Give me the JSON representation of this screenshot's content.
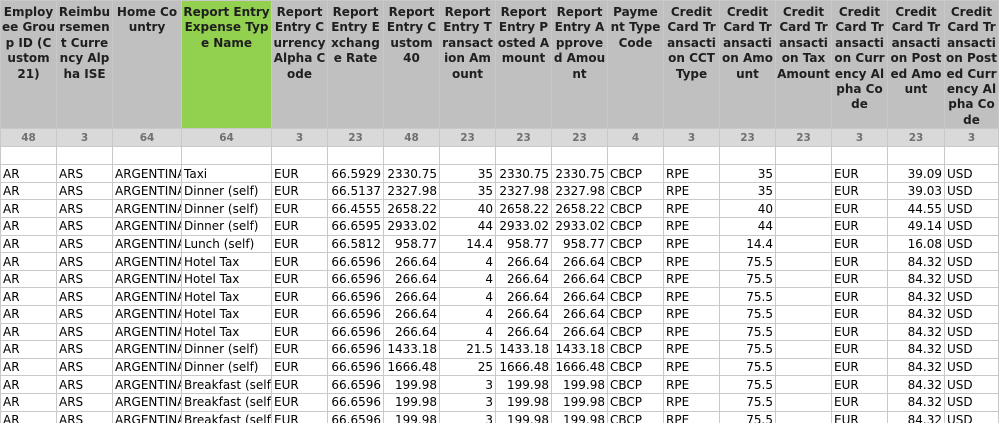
{
  "columns": [
    {
      "header": "Employee Group ID (Custom 21)",
      "length": "48",
      "align": "txt",
      "highlight": false
    },
    {
      "header": "Reimbursement Currency Alpha ISE",
      "length": "3",
      "align": "txt",
      "highlight": false
    },
    {
      "header": "Home Country",
      "length": "64",
      "align": "txt",
      "highlight": false
    },
    {
      "header": "Report Entry Expense Type Name",
      "length": "64",
      "align": "txt",
      "highlight": true
    },
    {
      "header": "Report Entry Currency Alpha Code",
      "length": "3",
      "align": "txt",
      "highlight": false
    },
    {
      "header": "Report Entry Exchange Rate",
      "length": "23",
      "align": "num",
      "highlight": false
    },
    {
      "header": "Report Entry Custom 40",
      "length": "48",
      "align": "num",
      "highlight": false
    },
    {
      "header": "Report Entry Transaction Amount",
      "length": "23",
      "align": "num",
      "highlight": false
    },
    {
      "header": "Report Entry Posted Amount",
      "length": "23",
      "align": "num",
      "highlight": false
    },
    {
      "header": "Report Entry Approved Amount",
      "length": "23",
      "align": "num",
      "highlight": false
    },
    {
      "header": "Payment Type Code",
      "length": "4",
      "align": "txt",
      "highlight": false
    },
    {
      "header": "Credit Card Transaction CCT Type",
      "length": "3",
      "align": "txt",
      "highlight": false
    },
    {
      "header": "Credit Card Transaction Amount",
      "length": "23",
      "align": "num",
      "highlight": false
    },
    {
      "header": "Credit Card Transaction Tax Amount",
      "length": "23",
      "align": "num",
      "highlight": false
    },
    {
      "header": "Credit Card Transaction Currency Alpha Code",
      "length": "3",
      "align": "txt",
      "highlight": false
    },
    {
      "header": "Credit Card Transaction Posted Amount",
      "length": "23",
      "align": "num",
      "highlight": false
    },
    {
      "header": "Credit Card Transaction Posted Currency Alpha Code",
      "length": "3",
      "align": "txt",
      "highlight": false
    }
  ],
  "rows": [
    [
      "AR",
      "ARS",
      "ARGENTINA",
      "Taxi",
      "EUR",
      "66.5929",
      "2330.75",
      "35",
      "2330.75",
      "2330.75",
      "CBCP",
      "RPE",
      "35",
      "",
      "EUR",
      "39.09",
      "USD"
    ],
    [
      "AR",
      "ARS",
      "ARGENTINA",
      "Dinner (self)",
      "EUR",
      "66.5137",
      "2327.98",
      "35",
      "2327.98",
      "2327.98",
      "CBCP",
      "RPE",
      "35",
      "",
      "EUR",
      "39.03",
      "USD"
    ],
    [
      "AR",
      "ARS",
      "ARGENTINA",
      "Dinner (self)",
      "EUR",
      "66.4555",
      "2658.22",
      "40",
      "2658.22",
      "2658.22",
      "CBCP",
      "RPE",
      "40",
      "",
      "EUR",
      "44.55",
      "USD"
    ],
    [
      "AR",
      "ARS",
      "ARGENTINA",
      "Dinner (self)",
      "EUR",
      "66.6595",
      "2933.02",
      "44",
      "2933.02",
      "2933.02",
      "CBCP",
      "RPE",
      "44",
      "",
      "EUR",
      "49.14",
      "USD"
    ],
    [
      "AR",
      "ARS",
      "ARGENTINA",
      "Lunch (self)",
      "EUR",
      "66.5812",
      "958.77",
      "14.4",
      "958.77",
      "958.77",
      "CBCP",
      "RPE",
      "14.4",
      "",
      "EUR",
      "16.08",
      "USD"
    ],
    [
      "AR",
      "ARS",
      "ARGENTINA",
      "Hotel Tax",
      "EUR",
      "66.6596",
      "266.64",
      "4",
      "266.64",
      "266.64",
      "CBCP",
      "RPE",
      "75.5",
      "",
      "EUR",
      "84.32",
      "USD"
    ],
    [
      "AR",
      "ARS",
      "ARGENTINA",
      "Hotel Tax",
      "EUR",
      "66.6596",
      "266.64",
      "4",
      "266.64",
      "266.64",
      "CBCP",
      "RPE",
      "75.5",
      "",
      "EUR",
      "84.32",
      "USD"
    ],
    [
      "AR",
      "ARS",
      "ARGENTINA",
      "Hotel Tax",
      "EUR",
      "66.6596",
      "266.64",
      "4",
      "266.64",
      "266.64",
      "CBCP",
      "RPE",
      "75.5",
      "",
      "EUR",
      "84.32",
      "USD"
    ],
    [
      "AR",
      "ARS",
      "ARGENTINA",
      "Hotel Tax",
      "EUR",
      "66.6596",
      "266.64",
      "4",
      "266.64",
      "266.64",
      "CBCP",
      "RPE",
      "75.5",
      "",
      "EUR",
      "84.32",
      "USD"
    ],
    [
      "AR",
      "ARS",
      "ARGENTINA",
      "Hotel Tax",
      "EUR",
      "66.6596",
      "266.64",
      "4",
      "266.64",
      "266.64",
      "CBCP",
      "RPE",
      "75.5",
      "",
      "EUR",
      "84.32",
      "USD"
    ],
    [
      "AR",
      "ARS",
      "ARGENTINA",
      "Dinner (self)",
      "EUR",
      "66.6596",
      "1433.18",
      "21.5",
      "1433.18",
      "1433.18",
      "CBCP",
      "RPE",
      "75.5",
      "",
      "EUR",
      "84.32",
      "USD"
    ],
    [
      "AR",
      "ARS",
      "ARGENTINA",
      "Dinner (self)",
      "EUR",
      "66.6596",
      "1666.48",
      "25",
      "1666.48",
      "1666.48",
      "CBCP",
      "RPE",
      "75.5",
      "",
      "EUR",
      "84.32",
      "USD"
    ],
    [
      "AR",
      "ARS",
      "ARGENTINA",
      "Breakfast (self)",
      "EUR",
      "66.6596",
      "199.98",
      "3",
      "199.98",
      "199.98",
      "CBCP",
      "RPE",
      "75.5",
      "",
      "EUR",
      "84.32",
      "USD"
    ],
    [
      "AR",
      "ARS",
      "ARGENTINA",
      "Breakfast (self)",
      "EUR",
      "66.6596",
      "199.98",
      "3",
      "199.98",
      "199.98",
      "CBCP",
      "RPE",
      "75.5",
      "",
      "EUR",
      "84.32",
      "USD"
    ],
    [
      "AR",
      "ARS",
      "ARGENTINA",
      "Breakfast (self)",
      "EUR",
      "66.6596",
      "199.98",
      "3",
      "199.98",
      "199.98",
      "CBCP",
      "RPE",
      "75.5",
      "",
      "EUR",
      "84.32",
      "USD"
    ]
  ]
}
